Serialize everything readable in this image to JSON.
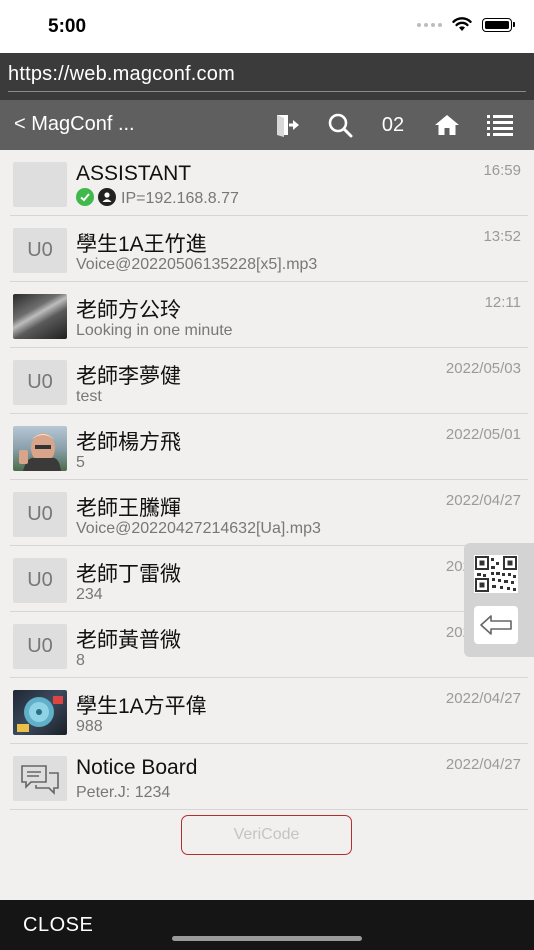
{
  "status_bar": {
    "time": "5:00"
  },
  "browser": {
    "url": "https://web.magconf.com"
  },
  "nav": {
    "back_title": "< MagConf ...",
    "count": "02"
  },
  "conversations": [
    {
      "name": "ASSISTANT",
      "subtitle": "IP=192.168.8.77",
      "time": "16:59",
      "avatar": "blank",
      "status_icons": [
        "check-circle-icon",
        "person-circle-icon"
      ]
    },
    {
      "name": "學生1A王竹進",
      "subtitle": "Voice@20220506135228[x5].mp3",
      "time": "13:52",
      "avatar": "U0"
    },
    {
      "name": "老師方公玲",
      "subtitle": "Looking in one minute",
      "time": "12:11",
      "avatar": "photo-dark"
    },
    {
      "name": "老師李夢健",
      "subtitle": "test",
      "time": "2022/05/03",
      "avatar": "U0"
    },
    {
      "name": "老師楊方飛",
      "subtitle": "5",
      "time": "2022/05/01",
      "avatar": "photo-person"
    },
    {
      "name": "老師王騰輝",
      "subtitle": "Voice@20220427214632[Ua].mp3",
      "time": "2022/04/27",
      "avatar": "U0"
    },
    {
      "name": "老師丁雷微",
      "subtitle": "234",
      "time": "2022/04/27",
      "avatar": "U0"
    },
    {
      "name": "老師黃普微",
      "subtitle": "8",
      "time": "2022/04/27",
      "avatar": "U0"
    },
    {
      "name": "學生1A方平偉",
      "subtitle": "988",
      "time": "2022/04/27",
      "avatar": "photo-fan"
    },
    {
      "name": "Notice Board",
      "subtitle": "Peter.J: 1234",
      "time": "2022/04/27",
      "avatar": "chat-bubbles-icon"
    }
  ],
  "vericode": {
    "label": "VeriCode"
  },
  "bottom": {
    "close_label": "CLOSE"
  },
  "colors": {
    "nav_bg": "#5f5f5f",
    "url_bg": "#3b3b3b",
    "accent_green": "#3fb94c",
    "vericode_border": "#b03030"
  }
}
